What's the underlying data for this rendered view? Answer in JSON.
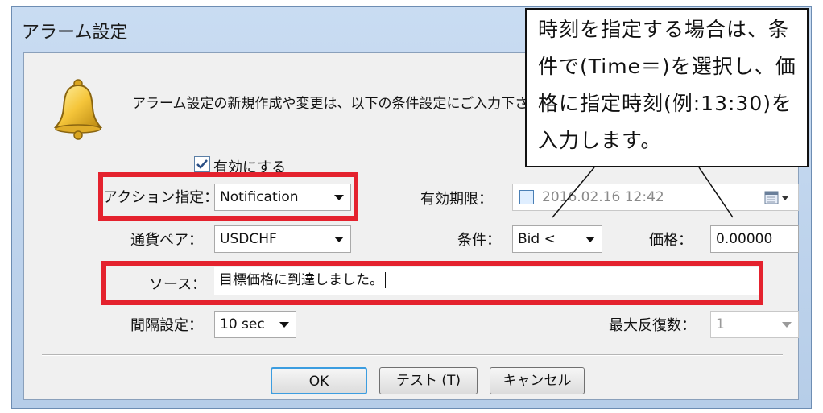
{
  "dialog": {
    "title": "アラーム設定",
    "description": "アラーム設定の新規作成や変更は、以下の条件設定にご入力下さい。",
    "enable_label": "有効にする",
    "enable_checked": true
  },
  "form": {
    "action_label": "アクション指定：",
    "action_value": "Notification",
    "expiry_label": "有効期限：",
    "expiry_value": "2016.02.16 12:42",
    "pair_label": "通貨ペア：",
    "pair_value": "USDCHF",
    "condition_label": "条件：",
    "condition_value": "Bid <",
    "price_label": "価格：",
    "price_value": "0.00000",
    "source_label": "ソース：",
    "source_value": "目標価格に到達しました。",
    "interval_label": "間隔設定：",
    "interval_value": "10 sec",
    "max_repeat_label": "最大反復数：",
    "max_repeat_value": "1"
  },
  "buttons": {
    "ok": "OK",
    "test": "テスト (T)",
    "cancel": "キャンセル"
  },
  "callout": {
    "line1": "時刻を指定する場合は、条",
    "line2": "件で(Time＝)を選択し、価",
    "line3": "格に指定時刻(例:13:30)を",
    "line4": "入力します。"
  },
  "colors": {
    "highlight": "#e4222e",
    "titlebar": "#c9dcf2",
    "ok_border": "#3c9de0"
  }
}
